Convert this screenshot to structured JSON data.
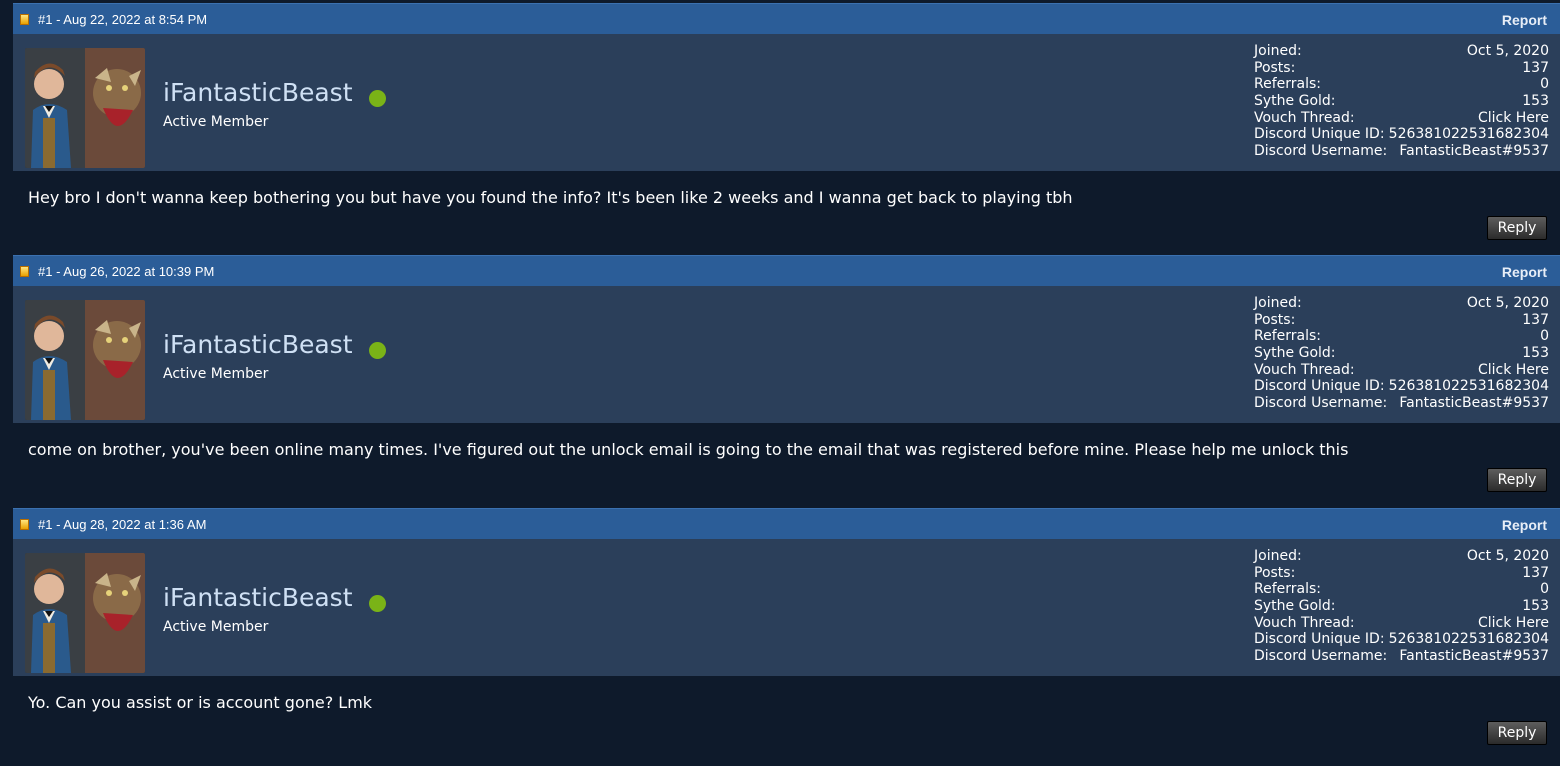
{
  "posts": [
    {
      "date": "#1 - Aug 22, 2022 at 8:54 PM",
      "report_label": "Report",
      "username": "iFantasticBeast",
      "user_title": "Active Member",
      "stats": {
        "joined_label": "Joined:",
        "joined": "Oct 5, 2020",
        "posts_label": "Posts:",
        "posts": "137",
        "referrals_label": "Referrals:",
        "referrals": "0",
        "gold_label": "Sythe Gold:",
        "gold": "153",
        "vouch_label": "Vouch Thread:",
        "vouch": "Click Here",
        "discord_id_label": "Discord Unique ID:",
        "discord_id": "526381022531682304",
        "discord_user_label": "Discord Username:",
        "discord_user": "FantasticBeast#9537"
      },
      "message": "Hey bro I don't wanna keep bothering you but have you found the info? It's been like 2 weeks and I wanna get back to playing tbh",
      "reply_label": "Reply"
    },
    {
      "date": "#1 - Aug 26, 2022 at 10:39 PM",
      "report_label": "Report",
      "username": "iFantasticBeast",
      "user_title": "Active Member",
      "stats": {
        "joined_label": "Joined:",
        "joined": "Oct 5, 2020",
        "posts_label": "Posts:",
        "posts": "137",
        "referrals_label": "Referrals:",
        "referrals": "0",
        "gold_label": "Sythe Gold:",
        "gold": "153",
        "vouch_label": "Vouch Thread:",
        "vouch": "Click Here",
        "discord_id_label": "Discord Unique ID:",
        "discord_id": "526381022531682304",
        "discord_user_label": "Discord Username:",
        "discord_user": "FantasticBeast#9537"
      },
      "message": "come on brother, you've been online many times. I've figured out the unlock email is going to the email that was registered before mine. Please help me unlock this",
      "reply_label": "Reply"
    },
    {
      "date": "#1 - Aug 28, 2022 at 1:36 AM",
      "report_label": "Report",
      "username": "iFantasticBeast",
      "user_title": "Active Member",
      "stats": {
        "joined_label": "Joined:",
        "joined": "Oct 5, 2020",
        "posts_label": "Posts:",
        "posts": "137",
        "referrals_label": "Referrals:",
        "referrals": "0",
        "gold_label": "Sythe Gold:",
        "gold": "153",
        "vouch_label": "Vouch Thread:",
        "vouch": "Click Here",
        "discord_id_label": "Discord Unique ID:",
        "discord_id": "526381022531682304",
        "discord_user_label": "Discord Username:",
        "discord_user": "FantasticBeast#9537"
      },
      "message": "Yo. Can you assist or is account gone? Lmk",
      "reply_label": "Reply"
    }
  ],
  "colors": {
    "header_bar": "#2b5d98",
    "user_panel": "#2b3f5a",
    "post_body": "#0e1a2b",
    "online": "#7ab317"
  },
  "icons": {
    "post_icon": "post-status-icon",
    "online_indicator": "online-status-icon"
  }
}
